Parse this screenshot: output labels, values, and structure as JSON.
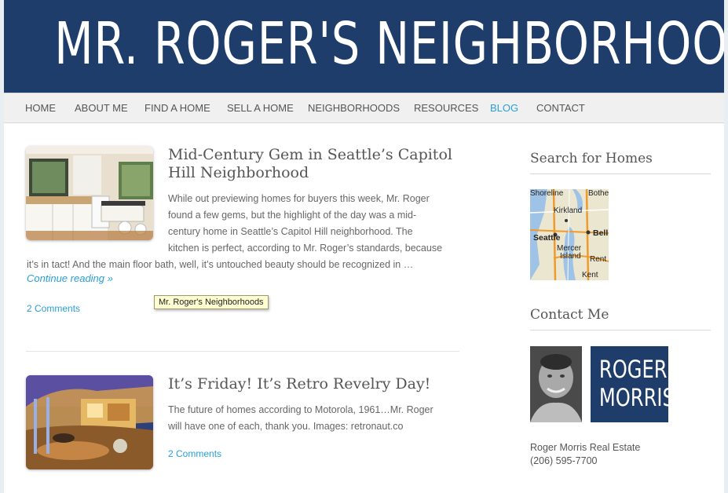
{
  "site": {
    "title": "MR. ROGER'S NEIGHBORHOODS",
    "tooltip": "Mr. Roger's Neighborhoods"
  },
  "nav": {
    "items": [
      {
        "label": "HOME"
      },
      {
        "label": "ABOUT ME"
      },
      {
        "label": "FIND A HOME"
      },
      {
        "label": "SELL A HOME"
      },
      {
        "label": "NEIGHBORHOODS"
      },
      {
        "label": "RESOURCES"
      },
      {
        "label": "BLOG",
        "active": true
      },
      {
        "label": "CONTACT"
      }
    ]
  },
  "posts": [
    {
      "title": "Mid-Century Gem in Seattle’s Capitol Hill Neighborhood",
      "excerpt_lines": [
        "While out previewing homes for buyers this week, Mr. Roger",
        "found a few gems, but the highlight of the day was a mid-",
        "century home in Seattle’s Capitol Hill neighborhood. The",
        "kitchen is perfect, according to Mr. Roger’s standards, because"
      ],
      "excerpt_wrap": "it’s in tact! And the main floor bath, well, it’s untouched beauty should be recognized in …",
      "read_more": "Continue reading »",
      "comments": "2 Comments"
    },
    {
      "title": "It’s Friday! It’s Retro Revelry Day!",
      "excerpt_lines": [
        "The future of homes according to Motorola, 1961…Mr. Roger",
        "will have one of each, thank you. Images: retronaut.co"
      ],
      "comments": "2 Comments"
    }
  ],
  "sidebar": {
    "search_title": "Search for Homes",
    "map_labels": {
      "shoreline": "Shoreline",
      "bothell": "Bothe",
      "kirkland": "Kirkland",
      "seattle": "Seattle",
      "bellevue": "Bell",
      "mercer": "Mercer",
      "island": "Island",
      "renton": "Rent",
      "kent": "Kent"
    },
    "contact_title": "Contact Me",
    "logo_line1": "ROGER",
    "logo_line2": "MORRIS",
    "company": "Roger Morris Real Estate",
    "phone": "(206) 595-7700"
  },
  "colors": {
    "brand_navy": "#1f3d6b",
    "link_blue": "#2a9fd6",
    "tooltip_bg": "#ffffd2"
  }
}
